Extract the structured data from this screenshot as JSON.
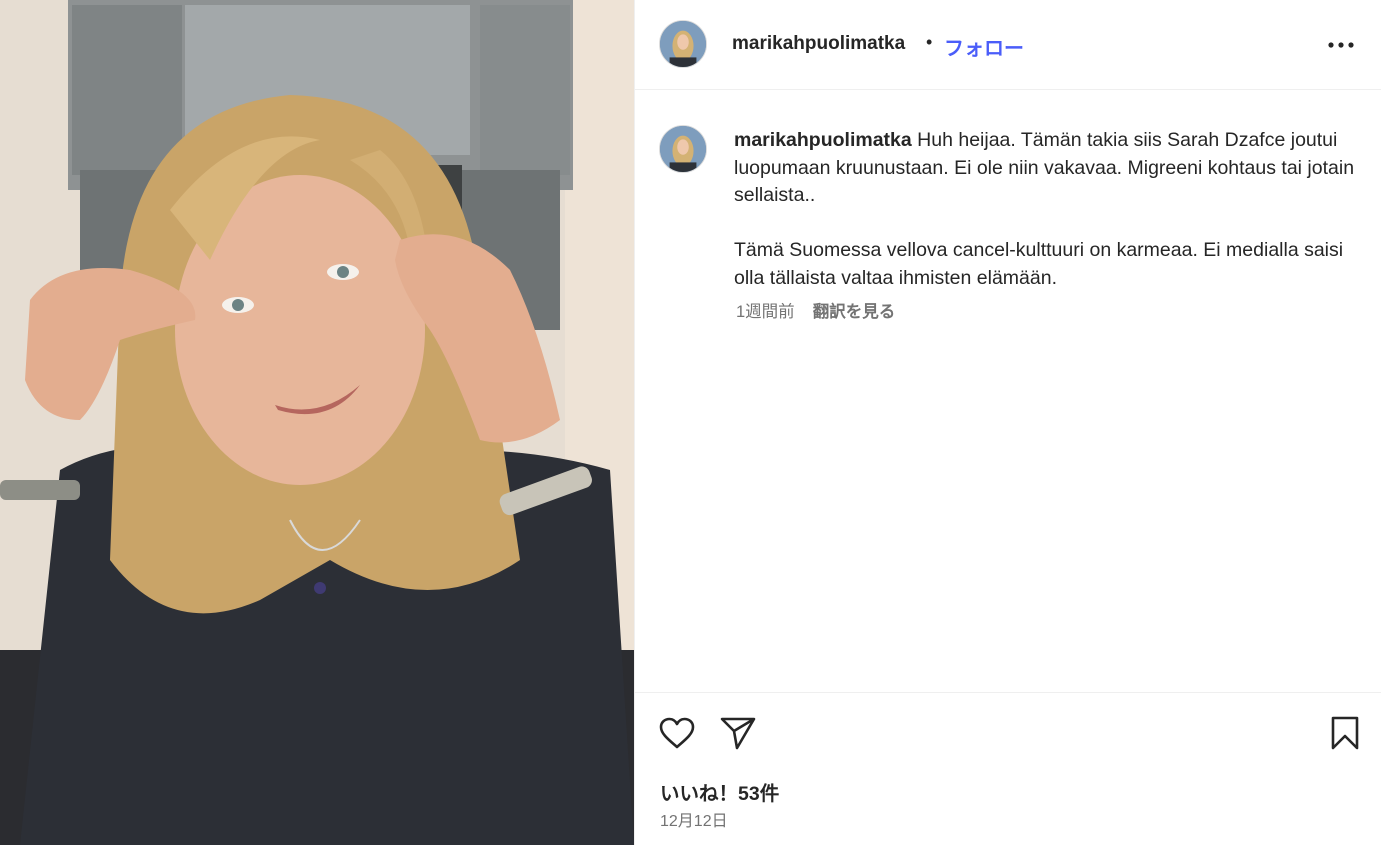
{
  "header": {
    "username": "marikahpuolimatka",
    "separator": "•",
    "follow_label": "フォロー",
    "more_icon": "more-horizontal-icon"
  },
  "caption": {
    "username": "marikahpuolimatka",
    "paragraph1": "Huh heijaa. Tämän takia siis Sarah Dzafce joutui luopumaan kruunustaan. Ei ole niin vakavaa. Migreeni kohtaus tai jotain sellaista..",
    "paragraph2": "Tämä Suomessa vellova cancel-kulttuuri on karmeaa. Ei medialla saisi olla tällaista valtaa ihmisten elämään.",
    "time_ago": "1週間前",
    "translate_label": "翻訳を見る"
  },
  "actions": {
    "like_icon": "heart-icon",
    "share_icon": "paper-plane-icon",
    "save_icon": "bookmark-icon",
    "likes_text": "いいね！53件",
    "date_text": "12月12日"
  },
  "colors": {
    "follow_blue": "#4a5df9",
    "text_primary": "#262626",
    "text_secondary": "#737373",
    "divider": "#efefef"
  }
}
